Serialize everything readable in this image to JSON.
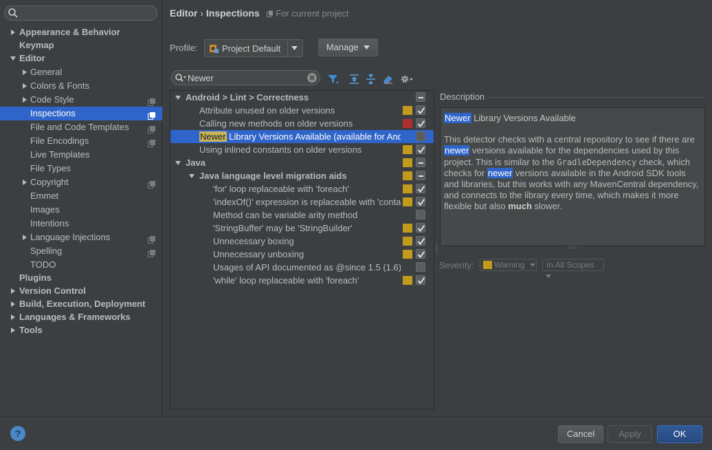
{
  "sidebar": {
    "search": {
      "value": ""
    },
    "items": [
      {
        "label": "Appearance & Behavior",
        "bold": true,
        "arrow": "right",
        "indent": 0
      },
      {
        "label": "Keymap",
        "bold": true,
        "arrow": "",
        "indent": 0
      },
      {
        "label": "Editor",
        "bold": true,
        "arrow": "down",
        "indent": 0
      },
      {
        "label": "General",
        "arrow": "right",
        "indent": 1
      },
      {
        "label": "Colors & Fonts",
        "arrow": "right",
        "indent": 1
      },
      {
        "label": "Code Style",
        "arrow": "right",
        "indent": 1,
        "copy": true
      },
      {
        "label": "Inspections",
        "arrow": "",
        "indent": 1,
        "copy": true,
        "selected": true
      },
      {
        "label": "File and Code Templates",
        "arrow": "",
        "indent": 1,
        "copy": true
      },
      {
        "label": "File Encodings",
        "arrow": "",
        "indent": 1,
        "copy": true
      },
      {
        "label": "Live Templates",
        "arrow": "",
        "indent": 1
      },
      {
        "label": "File Types",
        "arrow": "",
        "indent": 1
      },
      {
        "label": "Copyright",
        "arrow": "right",
        "indent": 1,
        "copy": true
      },
      {
        "label": "Emmet",
        "arrow": "",
        "indent": 1
      },
      {
        "label": "Images",
        "arrow": "",
        "indent": 1
      },
      {
        "label": "Intentions",
        "arrow": "",
        "indent": 1
      },
      {
        "label": "Language Injections",
        "arrow": "right",
        "indent": 1,
        "copy": true
      },
      {
        "label": "Spelling",
        "arrow": "",
        "indent": 1,
        "copy": true
      },
      {
        "label": "TODO",
        "arrow": "",
        "indent": 1
      },
      {
        "label": "Plugins",
        "bold": true,
        "arrow": "",
        "indent": 0
      },
      {
        "label": "Version Control",
        "bold": true,
        "arrow": "right",
        "indent": 0
      },
      {
        "label": "Build, Execution, Deployment",
        "bold": true,
        "arrow": "right",
        "indent": 0
      },
      {
        "label": "Languages & Frameworks",
        "bold": true,
        "arrow": "right",
        "indent": 0
      },
      {
        "label": "Tools",
        "bold": true,
        "arrow": "right",
        "indent": 0
      }
    ]
  },
  "header": {
    "crumb_editor": "Editor",
    "crumb_sep": "›",
    "crumb_page": "Inspections",
    "scope_note": "For current project"
  },
  "profile": {
    "label": "Profile:",
    "value": "Project Default",
    "manage_label": "Manage"
  },
  "filter": {
    "value": "Newer"
  },
  "inspections": [
    {
      "text": "Android > Lint > Correctness",
      "bold": true,
      "arrow": "down",
      "level": 0,
      "sev": "",
      "check": "dash"
    },
    {
      "text": "Attribute unused on older versions",
      "level": 1,
      "sev": "#c29a1c",
      "check": "checked"
    },
    {
      "text": "Calling new methods on older versions",
      "level": 1,
      "sev": "#b02e2e",
      "check": "checked"
    },
    {
      "hl": "Newer",
      "text": " Library Versions Available (available for Android)",
      "level": 1,
      "sev": "",
      "check": "unchecked",
      "selected": true
    },
    {
      "text": "Using inlined constants on older versions",
      "level": 1,
      "sev": "#c29a1c",
      "check": "checked"
    },
    {
      "text": "Java",
      "bold": true,
      "arrow": "down",
      "level": 0,
      "sev": "#c29a1c",
      "check": "dash"
    },
    {
      "text": "Java language level migration aids",
      "bold": true,
      "arrow": "down",
      "level": 1,
      "sev": "#c29a1c",
      "check": "dash"
    },
    {
      "text": "'for' loop replaceable with 'foreach'",
      "level": 2,
      "sev": "#c29a1c",
      "check": "checked"
    },
    {
      "text": "'indexOf()' expression is replaceable with 'contains()'",
      "level": 2,
      "sev": "#c29a1c",
      "check": "checked"
    },
    {
      "text": "Method can be variable arity method",
      "level": 2,
      "sev": "",
      "check": "unchecked"
    },
    {
      "text": "'StringBuffer' may be 'StringBuilder'",
      "level": 2,
      "sev": "#c29a1c",
      "check": "checked"
    },
    {
      "text": "Unnecessary boxing",
      "level": 2,
      "sev": "#c29a1c",
      "check": "checked"
    },
    {
      "text": "Unnecessary unboxing",
      "level": 2,
      "sev": "#c29a1c",
      "check": "checked"
    },
    {
      "text": "Usages of API documented as @since 1.5 (1.6)",
      "level": 2,
      "sev": "",
      "check": "unchecked"
    },
    {
      "text": "'while' loop replaceable with 'foreach'",
      "level": 2,
      "sev": "#c29a1c",
      "check": "checked"
    }
  ],
  "description": {
    "heading": "Description",
    "title_kw": "Newer",
    "title_rest": " Library Versions Available",
    "p1": "This detector checks with a central repository to see if there are ",
    "kw1": "newer",
    "p2": " versions available for the dependencies used by this project. This is similar to the ",
    "mono": "GradleDependency",
    "p3": " check, which checks for ",
    "kw2": "newer",
    "p4": " versions available in the Android SDK tools and libraries, but this works with any MavenCentral dependency, and connects to the library every time, which makes it more flexible but also ",
    "strong": "much",
    "p5": " slower."
  },
  "severity": {
    "label": "Severity:",
    "value": "Warning",
    "scope": "In All Scopes"
  },
  "buttons": {
    "help": "?",
    "cancel": "Cancel",
    "apply": "Apply",
    "ok": "OK"
  },
  "colors": {
    "selection": "#2f65ca",
    "warning": "#c29a1c",
    "error": "#b02e2e"
  }
}
